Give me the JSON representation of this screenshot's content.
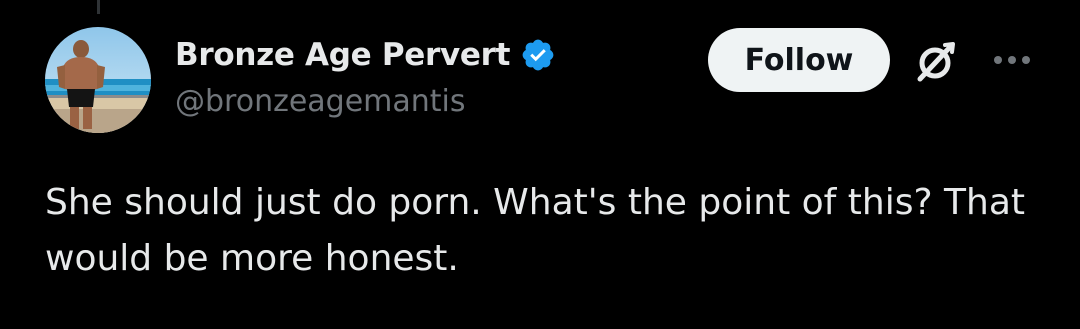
{
  "author": {
    "display_name": "Bronze Age Pervert",
    "handle": "@bronzeagemantis",
    "verified": true
  },
  "actions": {
    "follow_label": "Follow",
    "grok_icon": "grok-icon",
    "more_icon": "more-icon"
  },
  "tweet": {
    "text": "She should just do porn. What's the point of this? That would be more honest."
  },
  "colors": {
    "background": "#000000",
    "text_primary": "#e7e9ea",
    "text_secondary": "#71767b",
    "verified_blue": "#1d9bf0",
    "follow_bg": "#eff3f4",
    "follow_text": "#0f1419"
  }
}
